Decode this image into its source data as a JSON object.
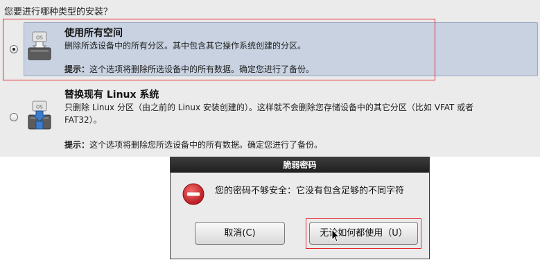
{
  "installer": {
    "question": "您要进行哪种类型的安装？",
    "options": [
      {
        "title": "使用所有空间",
        "description": "删除所选设备中的所有分区。其中包含其它操作系统创建的分区。",
        "tip_label": "提示：",
        "tip_text": "这个选项将删除所选设备中的所有数据。确定您进行了备份。",
        "selected": true,
        "icon": "disk-erase-icon",
        "icon_text": "OS"
      },
      {
        "title": "替换现有 Linux 系统",
        "description_line1": "只删除 Linux 分区（由之前的 Linux 安装创建的）。这样就不会删除您存储设备中的其它分区（比如 VFAT 或者",
        "description_line2": "FAT32）。",
        "tip_label": "提示：",
        "tip_text": "这个选项将删除您所选设备中的所有数据。确定您进行了备份。",
        "selected": false,
        "icon": "disk-replace-icon",
        "icon_text": "OS"
      }
    ]
  },
  "dialog": {
    "title": "脆弱密码",
    "message": "您的密码不够安全：它没有包含足够的不同字符",
    "icon": "error-icon",
    "buttons": {
      "cancel": "取消(C)",
      "use_anyway": "无论如何都使用（U）"
    }
  },
  "colors": {
    "highlight": "#e3262b",
    "selected_row": "#c8d2e1",
    "error_red": "#d8262b"
  }
}
